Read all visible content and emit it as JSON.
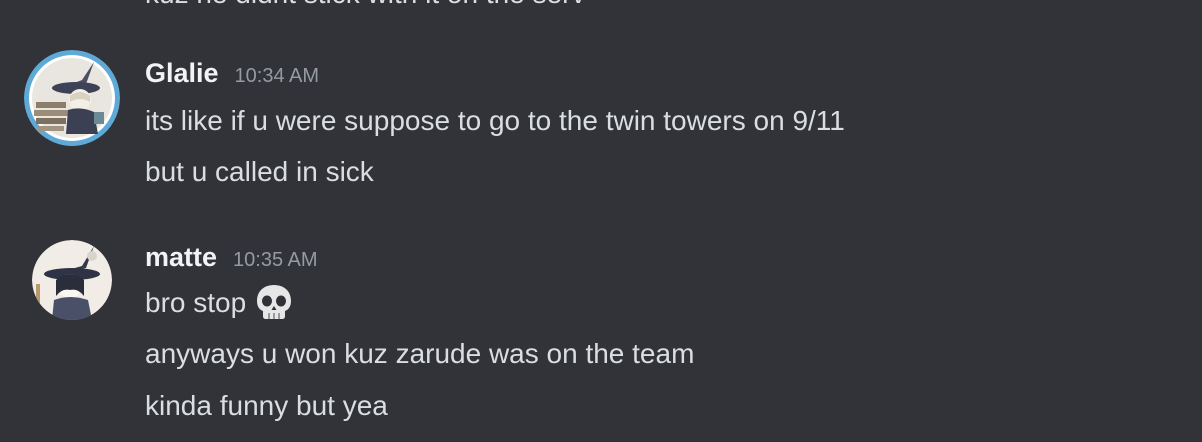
{
  "clipped_previous_message": "kuz he didnt stick with it on the serv",
  "messages": [
    {
      "username": "Glalie",
      "timestamp": "10:34 AM",
      "avatar_icon": "witch-avatar-icon",
      "lines": [
        "its like if u were suppose to go to the twin towers on 9/11",
        "but u called in sick"
      ]
    },
    {
      "username": "matte",
      "timestamp": "10:35 AM",
      "avatar_icon": "witch-avatar-icon",
      "lines": [
        "bro stop",
        "anyways u won kuz zarude was on the team",
        "kinda funny but yea"
      ],
      "emoji": "skull-emoji"
    }
  ],
  "colors": {
    "background": "#313338",
    "username": "#f2f3f5",
    "timestamp": "#949ba4",
    "text": "#dbdee1",
    "avatar_ring": "#5fa9d6"
  }
}
